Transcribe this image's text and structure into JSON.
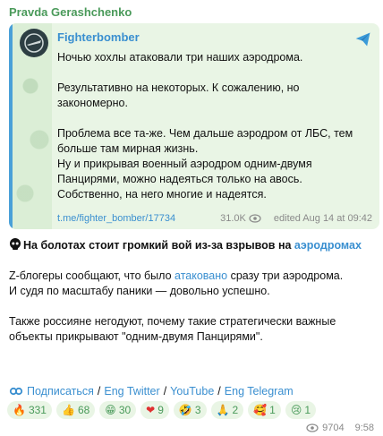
{
  "post": {
    "channel": "Pravda Gerashchenko",
    "forwarded": {
      "source": "Fighterbomber",
      "paragraphs": [
        "Ночью хохлы атаковали три наших аэродрома.",
        "Результативно на некоторых. К сожалению, но закономерно.",
        "Проблема все та-же. Чем дальше аэродром от ЛБС, тем больше там мирная жизнь.\nНу и прикрывая военный аэродром одним-двумя Панцирями, можно надеяться только на авось.\nСобственно, на него многие и надеятся."
      ],
      "link": "t.me/fighter_bomber/17734",
      "views": "31.0K",
      "edited": "edited  Aug 14 at 09:42"
    },
    "headline_pre": "На болотах стоит громкий вой из-за взрывов на ",
    "headline_link": "аэродромах",
    "para1_pre": "Z-блогеры сообщают, что было ",
    "para1_link": "атаковано",
    "para1_post": " сразу три аэродрома.",
    "para1_line2": "И судя по масштабу паники — довольно успешно.",
    "para2": "Также россияне негодуют, почему такие стратегически важные объекты прикрывают \"одним-двумя Панцирями\".",
    "links": [
      "Подписаться",
      "Eng Twitter",
      "YouTube",
      "Eng Telegram"
    ],
    "link_separator": "/",
    "reactions": [
      {
        "emoji": "🔥",
        "count": "331"
      },
      {
        "emoji": "👍",
        "count": "68"
      },
      {
        "emoji": "😁",
        "count": "30"
      },
      {
        "emoji": "❤",
        "count": "9"
      },
      {
        "emoji": "🤣",
        "count": "3"
      },
      {
        "emoji": "🙏",
        "count": "2"
      },
      {
        "emoji": "🥰",
        "count": "1"
      },
      {
        "emoji": "😢",
        "count": "1"
      }
    ],
    "views": "9704",
    "time": "9:58"
  },
  "icons": {
    "share": "share-icon",
    "eye": "eye-icon",
    "skull": "skull-icon",
    "link_emoji": "link-icon"
  },
  "colors": {
    "channel": "#4a9a5a",
    "link": "#3a8fd0",
    "card_bg": "#e9f5e5",
    "accent": "#4aa0d8"
  }
}
